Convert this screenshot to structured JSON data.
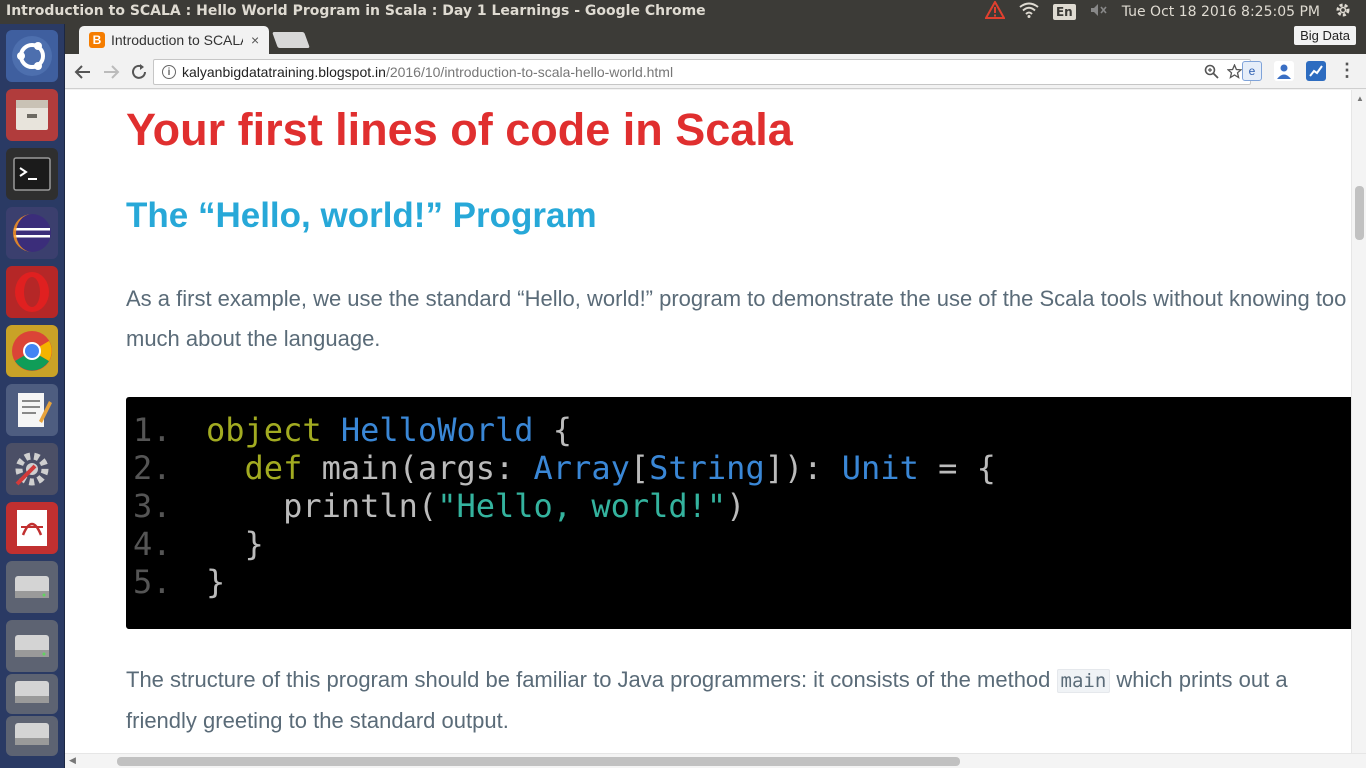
{
  "top_panel": {
    "window_title": "Introduction to SCALA : Hello World Program in Scala : Day 1 Learnings - Google Chrome",
    "keyboard_layout": "En",
    "datetime": "Tue Oct 18 2016  8:25:05 PM",
    "icons": [
      "warning-icon",
      "wifi-icon",
      "volume-muted-icon",
      "settings-gear-icon"
    ]
  },
  "launcher": {
    "items": [
      "ubuntu-dash",
      "files",
      "terminal",
      "eclipse",
      "opera",
      "chrome",
      "text-editor",
      "system-settings",
      "pdf-viewer",
      "drive",
      "drive",
      "drive",
      "drive"
    ]
  },
  "browser": {
    "tab_title": "Introduction to SCALA",
    "tab_close": "×",
    "profile_badge": "Big Data",
    "url_host": "kalyanbigdatatraining.blogspot.in",
    "url_path": "/2016/10/introduction-to-scala-hello-world.html"
  },
  "page": {
    "heading": "Your first lines of code in Scala",
    "subheading": "The “Hello, world!” Program",
    "para1": "As a first example, we use the standard “Hello, world!” program to demonstrate the use of the Scala tools without knowing too much about the language.",
    "para2_before": "The structure of this program should be familiar to Java programmers: it consists of the method ",
    "para2_code": "main",
    "para2_after": " which prints out a friendly greeting to the standard output.",
    "code": {
      "line_numbers": [
        "1.",
        "2.",
        "3.",
        "4.",
        "5."
      ],
      "l1_kw": "object",
      "l1_name": "HelloWorld",
      "l1_rest": " {",
      "l2_indent": "  ",
      "l2_kw": "def",
      "l2_a": " main(args: ",
      "l2_t1": "Array",
      "l2_b": "[",
      "l2_t2": "String",
      "l2_c": "]): ",
      "l2_t3": "Unit",
      "l2_d": " = {",
      "l3_a": "    println(",
      "l3_str": "\"Hello, world!\"",
      "l3_b": ")",
      "l4": "  }",
      "l5": "}"
    }
  },
  "colors": {
    "heading": "#e02f2f",
    "subheading": "#27a8d8",
    "body_text": "#5a6b78",
    "code_bg": "#000000",
    "keyword": "#a2ab21",
    "type": "#3a87d6",
    "string": "#34b39e"
  }
}
